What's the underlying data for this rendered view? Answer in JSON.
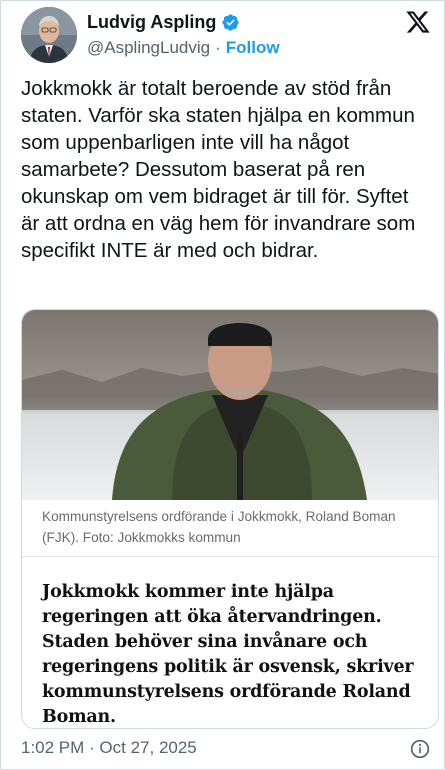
{
  "author": {
    "name": "Ludvig Aspling",
    "handle": "@AsplingLudvig",
    "follow_label": "Follow",
    "separator": "·"
  },
  "tweet": {
    "text": "Jokkmokk är totalt beroende av stöd från staten. Varför ska staten hjälpa en kommun som uppenbarligen inte vill ha något samarbete? Dessutom baserat på ren okunskap om vem bidraget är till för. Syftet är att ordna en väg hem för invandrare som specifikt INTE är med och bidrar."
  },
  "card": {
    "caption": "Kommunstyrelsens ordförande i Jokkmokk, Roland Boman (FJK). Foto: Jokkmokks kommun",
    "headline": "Jokkmokk kommer inte hjälpa regeringen att öka återvandringen. Staden behöver sina invånare och regeringens politik är osvensk, skriver kommunstyrelsens ordförande Roland Boman."
  },
  "footer": {
    "timestamp": "1:02 PM · Oct 27, 2025"
  },
  "colors": {
    "link": "#1d9bf0",
    "secondary_text": "#536471",
    "border": "#cfd9de"
  },
  "icons": [
    "verified-badge-icon",
    "x-logo-icon",
    "info-icon"
  ]
}
